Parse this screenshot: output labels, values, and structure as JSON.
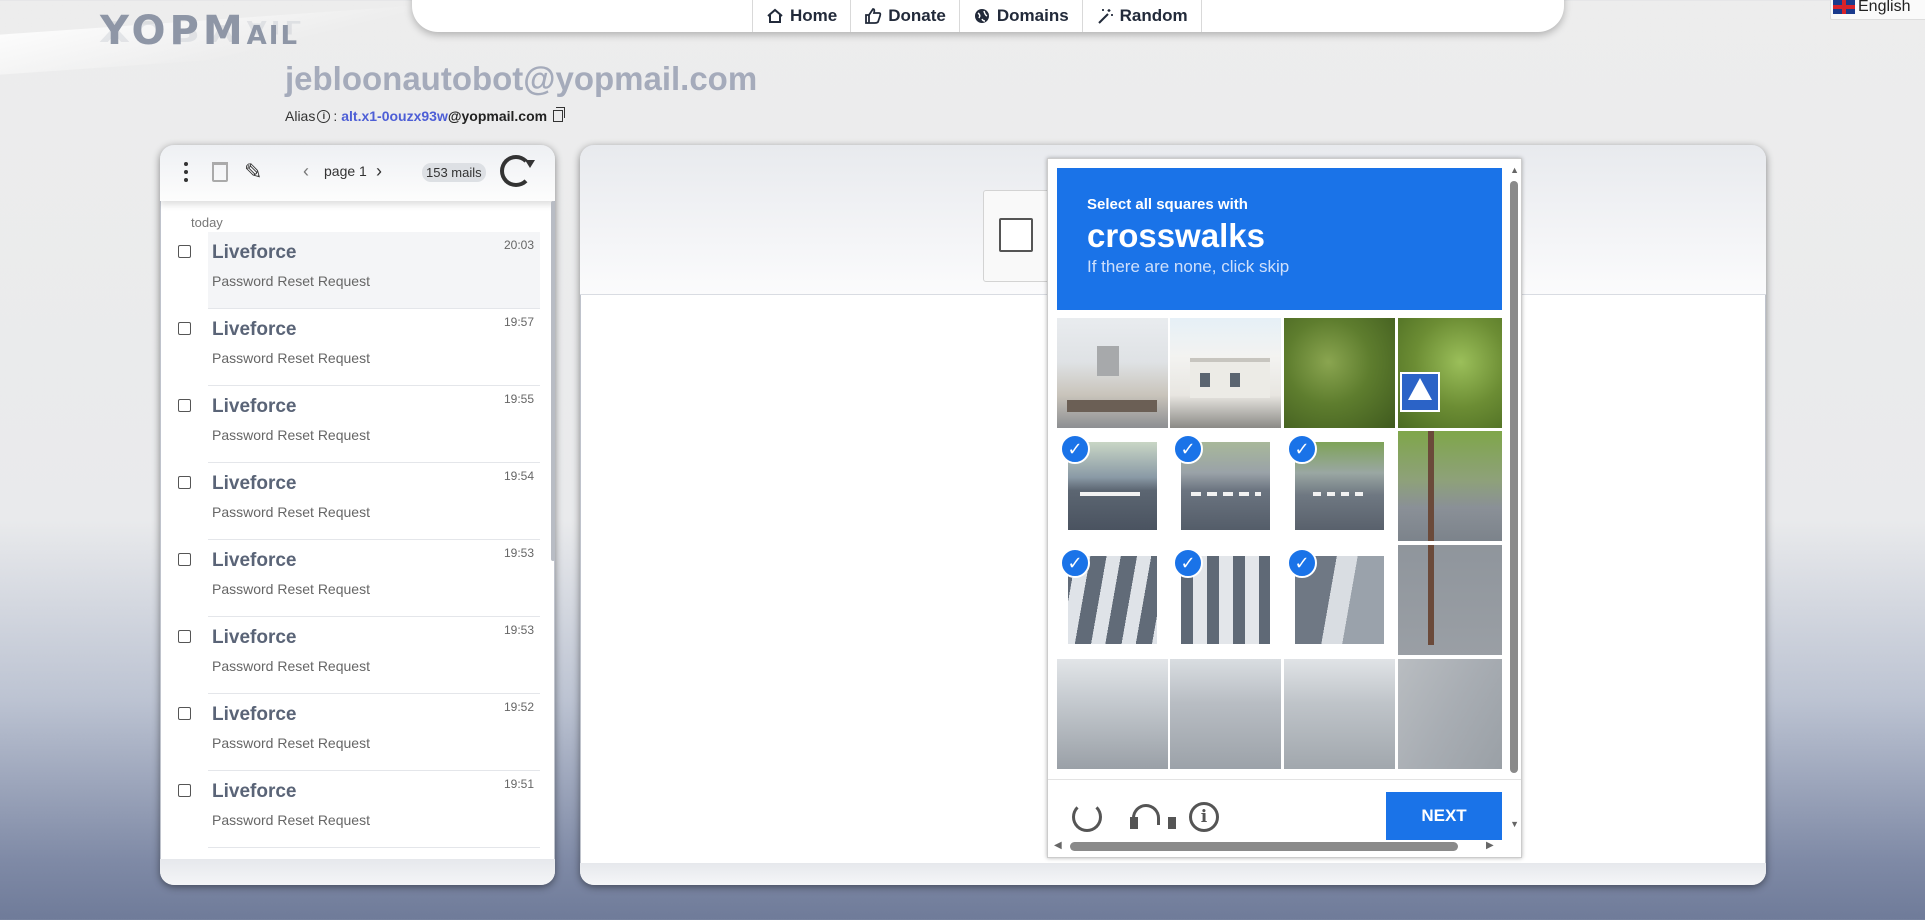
{
  "logo": {
    "text_main": "YOPM",
    "text_small": "AIL"
  },
  "nav": {
    "items": [
      {
        "label": "Home",
        "icon": "home-icon"
      },
      {
        "label": "Donate",
        "icon": "thumbs-up-icon"
      },
      {
        "label": "Domains",
        "icon": "globe-icon"
      },
      {
        "label": "Random",
        "icon": "magic-wand-icon"
      }
    ],
    "language": "English"
  },
  "mailbox": {
    "address": "jebloonautobot@yopmail.com",
    "alias_label": "Alias",
    "alias_sep": ":",
    "alias_name": "alt.x1-0ouzx93w",
    "alias_domain": "@yopmail.com"
  },
  "inbox": {
    "page_label": "page 1",
    "mail_count": "153 mails",
    "day_label": "today",
    "mails": [
      {
        "from": "Liveforce",
        "subject": "Password Reset Request",
        "time": "20:03"
      },
      {
        "from": "Liveforce",
        "subject": "Password Reset Request",
        "time": "19:57"
      },
      {
        "from": "Liveforce",
        "subject": "Password Reset Request",
        "time": "19:55"
      },
      {
        "from": "Liveforce",
        "subject": "Password Reset Request",
        "time": "19:54"
      },
      {
        "from": "Liveforce",
        "subject": "Password Reset Request",
        "time": "19:53"
      },
      {
        "from": "Liveforce",
        "subject": "Password Reset Request",
        "time": "19:53"
      },
      {
        "from": "Liveforce",
        "subject": "Password Reset Request",
        "time": "19:52"
      },
      {
        "from": "Liveforce",
        "subject": "Password Reset Request",
        "time": "19:51"
      }
    ]
  },
  "captcha": {
    "line1": "Select all squares with",
    "line2": "crosswalks",
    "line3": "If there are none, click skip",
    "next_label": "NEXT",
    "accent": "#1a73e8",
    "selected_tiles": [
      4,
      5,
      6,
      8,
      9,
      10
    ]
  }
}
